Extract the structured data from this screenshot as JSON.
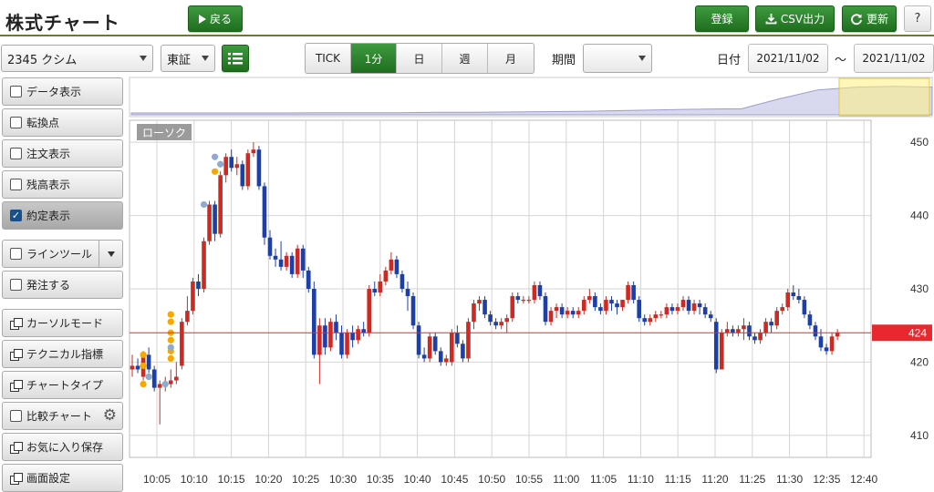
{
  "header": {
    "title": "株式チャート",
    "back_label": "戻る",
    "register_label": "登録",
    "csv_label": "CSV出力",
    "refresh_label": "更新",
    "help_label": "?"
  },
  "toolbar": {
    "stock_select": "2345 クシム",
    "market_select": "東証",
    "intervals": [
      "TICK",
      "1分",
      "日",
      "週",
      "月"
    ],
    "active_interval": "1分",
    "period_label": "期間",
    "period_value": "",
    "date_label": "日付",
    "date_from": "2021/11/02",
    "date_sep": "～",
    "date_to": "2021/11/02"
  },
  "sidebar": {
    "items": [
      {
        "label": "データ表示",
        "kind": "check",
        "checked": false
      },
      {
        "label": "転換点",
        "kind": "check",
        "checked": false
      },
      {
        "label": "注文表示",
        "kind": "check",
        "checked": false
      },
      {
        "label": "残高表示",
        "kind": "check",
        "checked": false
      },
      {
        "label": "約定表示",
        "kind": "check",
        "checked": true
      },
      {
        "label": "ラインツール",
        "kind": "check-dropdown",
        "checked": false
      },
      {
        "label": "発注する",
        "kind": "check",
        "checked": false
      },
      {
        "label": "カーソルモード",
        "kind": "window"
      },
      {
        "label": "テクニカル指標",
        "kind": "window"
      },
      {
        "label": "チャートタイプ",
        "kind": "window"
      },
      {
        "label": "比較チャート",
        "kind": "check-gear",
        "checked": false
      },
      {
        "label": "お気に入り保存",
        "kind": "window"
      },
      {
        "label": "画面設定",
        "kind": "window"
      }
    ]
  },
  "colors": {
    "up": "#cc2a22",
    "down": "#1d3fa8",
    "buy_marker": "#f5a800",
    "sell_marker": "#8fa9cf",
    "current_price": "#e8282e",
    "accent": "#2a7f2a"
  },
  "chart_data": {
    "type": "candlestick",
    "label": "ローソク",
    "x_ticks": [
      "10:05",
      "10:10",
      "10:15",
      "10:20",
      "10:25",
      "10:30",
      "10:35",
      "10:40",
      "10:45",
      "10:50",
      "10:55",
      "11:00",
      "11:05",
      "11:10",
      "11:15",
      "11:20",
      "11:25",
      "11:30",
      "12:35",
      "12:40"
    ],
    "y_ticks": [
      410,
      420,
      430,
      440,
      450
    ],
    "ylim": [
      407,
      453
    ],
    "current_price": 424,
    "current_price_label": "424",
    "candles": [
      [
        419.0,
        421.0,
        418.0,
        419.5
      ],
      [
        419.5,
        420.5,
        418.5,
        419.0
      ],
      [
        418.0,
        421.5,
        417.5,
        421.0
      ],
      [
        421.0,
        422.0,
        418.5,
        419.0
      ],
      [
        419.0,
        419.5,
        416.0,
        416.5
      ],
      [
        416.5,
        417.5,
        411.5,
        417.0
      ],
      [
        417.0,
        418.0,
        416.0,
        417.0
      ],
      [
        417.0,
        419.0,
        416.5,
        417.5
      ],
      [
        417.5,
        420.0,
        417.0,
        418.0
      ],
      [
        419.5,
        426.0,
        419.0,
        425.5
      ],
      [
        425.5,
        429.0,
        425.0,
        427.0
      ],
      [
        427.0,
        431.5,
        426.5,
        431.0
      ],
      [
        431.0,
        432.0,
        429.0,
        430.0
      ],
      [
        430.0,
        437.0,
        429.5,
        436.5
      ],
      [
        436.5,
        442.0,
        436.0,
        441.5
      ],
      [
        441.5,
        442.0,
        436.5,
        437.5
      ],
      [
        437.5,
        446.0,
        437.0,
        445.5
      ],
      [
        445.5,
        448.5,
        444.5,
        448.0
      ],
      [
        448.0,
        449.0,
        446.0,
        446.5
      ],
      [
        446.5,
        448.0,
        445.5,
        447.0
      ],
      [
        447.0,
        447.5,
        443.5,
        444.0
      ],
      [
        444.0,
        449.0,
        443.5,
        448.5
      ],
      [
        448.5,
        450.0,
        448.0,
        449.0
      ],
      [
        449.0,
        449.5,
        443.5,
        444.0
      ],
      [
        444.0,
        444.5,
        436.0,
        437.0
      ],
      [
        437.0,
        438.0,
        434.0,
        434.5
      ],
      [
        434.5,
        435.5,
        433.0,
        434.0
      ],
      [
        434.0,
        436.5,
        432.5,
        433.0
      ],
      [
        433.0,
        435.0,
        432.5,
        434.5
      ],
      [
        434.5,
        435.0,
        431.5,
        432.0
      ],
      [
        432.0,
        436.0,
        431.5,
        435.5
      ],
      [
        435.5,
        436.0,
        431.5,
        432.5
      ],
      [
        432.5,
        433.0,
        429.5,
        430.0
      ],
      [
        430.0,
        431.0,
        420.5,
        421.0
      ],
      [
        421.0,
        426.0,
        417.0,
        425.0
      ],
      [
        425.0,
        426.0,
        421.0,
        422.0
      ],
      [
        422.0,
        426.0,
        421.5,
        425.5
      ],
      [
        425.5,
        426.5,
        423.0,
        424.0
      ],
      [
        424.0,
        425.0,
        420.5,
        421.0
      ],
      [
        421.0,
        424.5,
        420.5,
        424.0
      ],
      [
        424.0,
        425.0,
        422.0,
        423.0
      ],
      [
        423.0,
        425.0,
        422.5,
        424.5
      ],
      [
        424.5,
        425.5,
        423.5,
        424.0
      ],
      [
        424.0,
        430.5,
        423.5,
        430.0
      ],
      [
        430.0,
        431.0,
        429.0,
        429.5
      ],
      [
        429.5,
        432.0,
        429.0,
        431.0
      ],
      [
        431.0,
        433.0,
        430.5,
        432.5
      ],
      [
        432.5,
        435.0,
        432.0,
        434.0
      ],
      [
        434.0,
        434.5,
        431.5,
        432.0
      ],
      [
        432.0,
        432.5,
        429.5,
        430.0
      ],
      [
        430.0,
        431.0,
        427.0,
        429.0
      ],
      [
        429.0,
        429.5,
        424.5,
        425.0
      ],
      [
        425.0,
        425.5,
        420.5,
        421.0
      ],
      [
        421.0,
        422.0,
        420.0,
        420.5
      ],
      [
        420.5,
        424.0,
        420.0,
        423.5
      ],
      [
        423.5,
        424.0,
        421.0,
        421.5
      ],
      [
        421.5,
        422.0,
        419.5,
        420.0
      ],
      [
        420.0,
        421.0,
        419.5,
        420.5
      ],
      [
        420.0,
        424.5,
        419.5,
        424.0
      ],
      [
        424.0,
        425.0,
        422.0,
        422.5
      ],
      [
        422.5,
        423.0,
        420.0,
        420.5
      ],
      [
        420.5,
        426.0,
        420.0,
        425.5
      ],
      [
        425.5,
        428.5,
        424.5,
        428.0
      ],
      [
        428.0,
        429.0,
        427.0,
        428.5
      ],
      [
        428.5,
        429.0,
        426.0,
        426.5
      ],
      [
        426.5,
        427.0,
        425.0,
        425.5
      ],
      [
        425.5,
        426.0,
        424.5,
        425.0
      ],
      [
        425.0,
        426.0,
        424.5,
        425.5
      ],
      [
        425.5,
        426.5,
        424.0,
        426.0
      ],
      [
        426.0,
        429.5,
        425.5,
        429.0
      ],
      [
        429.0,
        429.5,
        428.0,
        428.5
      ],
      [
        428.5,
        429.0,
        428.0,
        428.5
      ],
      [
        428.5,
        429.0,
        428.0,
        428.5
      ],
      [
        428.5,
        431.0,
        428.0,
        430.5
      ],
      [
        430.5,
        431.0,
        428.5,
        429.0
      ],
      [
        429.0,
        429.5,
        425.0,
        425.5
      ],
      [
        425.5,
        427.5,
        425.0,
        427.0
      ],
      [
        427.0,
        428.0,
        426.0,
        427.5
      ],
      [
        427.5,
        428.0,
        426.0,
        426.5
      ],
      [
        426.5,
        427.5,
        426.0,
        427.0
      ],
      [
        427.0,
        427.5,
        426.0,
        426.5
      ],
      [
        426.5,
        427.5,
        426.0,
        427.0
      ],
      [
        427.0,
        429.0,
        426.5,
        428.5
      ],
      [
        428.5,
        430.0,
        428.0,
        429.0
      ],
      [
        429.0,
        429.5,
        427.0,
        427.5
      ],
      [
        427.5,
        428.0,
        426.5,
        427.0
      ],
      [
        427.0,
        429.0,
        426.5,
        428.5
      ],
      [
        428.5,
        429.0,
        427.0,
        428.0
      ],
      [
        428.0,
        428.5,
        426.5,
        427.5
      ],
      [
        427.5,
        428.5,
        427.0,
        428.5
      ],
      [
        428.5,
        431.0,
        428.0,
        430.5
      ],
      [
        430.5,
        431.0,
        428.0,
        428.5
      ],
      [
        428.5,
        429.0,
        425.5,
        426.0
      ],
      [
        426.0,
        426.5,
        425.0,
        425.5
      ],
      [
        425.5,
        426.5,
        425.0,
        426.0
      ],
      [
        426.0,
        427.0,
        425.5,
        426.5
      ],
      [
        426.5,
        427.0,
        426.0,
        426.5
      ],
      [
        426.5,
        428.0,
        426.0,
        427.5
      ],
      [
        427.5,
        428.0,
        426.5,
        427.0
      ],
      [
        427.0,
        428.0,
        426.5,
        427.5
      ],
      [
        427.5,
        429.0,
        427.0,
        428.5
      ],
      [
        428.5,
        429.0,
        426.5,
        427.0
      ],
      [
        427.0,
        428.5,
        426.5,
        428.0
      ],
      [
        428.0,
        428.5,
        426.5,
        427.5
      ],
      [
        427.5,
        428.0,
        426.0,
        426.5
      ],
      [
        426.5,
        427.0,
        425.5,
        426.0
      ],
      [
        425.5,
        426.0,
        418.5,
        419.0
      ],
      [
        419.0,
        424.5,
        419.0,
        424.0
      ],
      [
        424.0,
        425.5,
        423.5,
        424.5
      ],
      [
        424.5,
        425.0,
        423.5,
        424.0
      ],
      [
        424.0,
        425.0,
        423.5,
        424.5
      ],
      [
        424.5,
        426.0,
        423.0,
        425.0
      ],
      [
        425.0,
        425.5,
        423.0,
        423.5
      ],
      [
        423.5,
        424.0,
        422.5,
        423.0
      ],
      [
        423.0,
        424.5,
        422.5,
        424.0
      ],
      [
        424.0,
        426.0,
        423.5,
        425.5
      ],
      [
        425.5,
        426.0,
        424.0,
        425.0
      ],
      [
        425.0,
        427.5,
        424.5,
        427.0
      ],
      [
        427.0,
        428.0,
        426.5,
        427.5
      ],
      [
        427.5,
        430.0,
        427.0,
        429.5
      ],
      [
        429.5,
        430.5,
        428.5,
        429.0
      ],
      [
        429.0,
        430.0,
        428.0,
        428.5
      ],
      [
        428.5,
        429.0,
        426.0,
        426.5
      ],
      [
        426.5,
        427.0,
        424.5,
        425.0
      ],
      [
        425.0,
        425.5,
        423.0,
        423.5
      ],
      [
        423.5,
        424.5,
        421.5,
        422.0
      ],
      [
        422.0,
        422.5,
        421.0,
        421.5
      ],
      [
        421.5,
        424.0,
        421.0,
        423.5
      ],
      [
        423.5,
        424.5,
        423.0,
        424.0
      ]
    ],
    "trade_markers": [
      {
        "side": "buy",
        "candle": 2,
        "prices": [
          421.0,
          419.5,
          417.0
        ]
      },
      {
        "side": "sell",
        "candle": 3,
        "prices": [
          418.0
        ]
      },
      {
        "side": "sell",
        "candle": 6,
        "prices": [
          417.0
        ]
      },
      {
        "side": "buy",
        "candle": 7,
        "prices": [
          426.5,
          425.5,
          424.0,
          423.0,
          421.5,
          420.5
        ]
      },
      {
        "side": "sell",
        "candle": 7,
        "prices": [
          422.0
        ]
      },
      {
        "side": "sell",
        "candle": 13,
        "prices": [
          441.5
        ]
      },
      {
        "side": "sell",
        "candle": 15,
        "prices": [
          448.0
        ]
      },
      {
        "side": "buy",
        "candle": 15,
        "prices": [
          446.0
        ]
      },
      {
        "side": "sell",
        "candle": 16,
        "prices": [
          447.0
        ]
      }
    ]
  },
  "overview": {
    "values": [
      0.05,
      0.05,
      0.05,
      0.05,
      0.05,
      0.06,
      0.06,
      0.06,
      0.07,
      0.07,
      0.08,
      0.09,
      0.1,
      0.12,
      0.14,
      0.16,
      0.17,
      0.45,
      0.7,
      0.78,
      0.8,
      0.78
    ]
  }
}
